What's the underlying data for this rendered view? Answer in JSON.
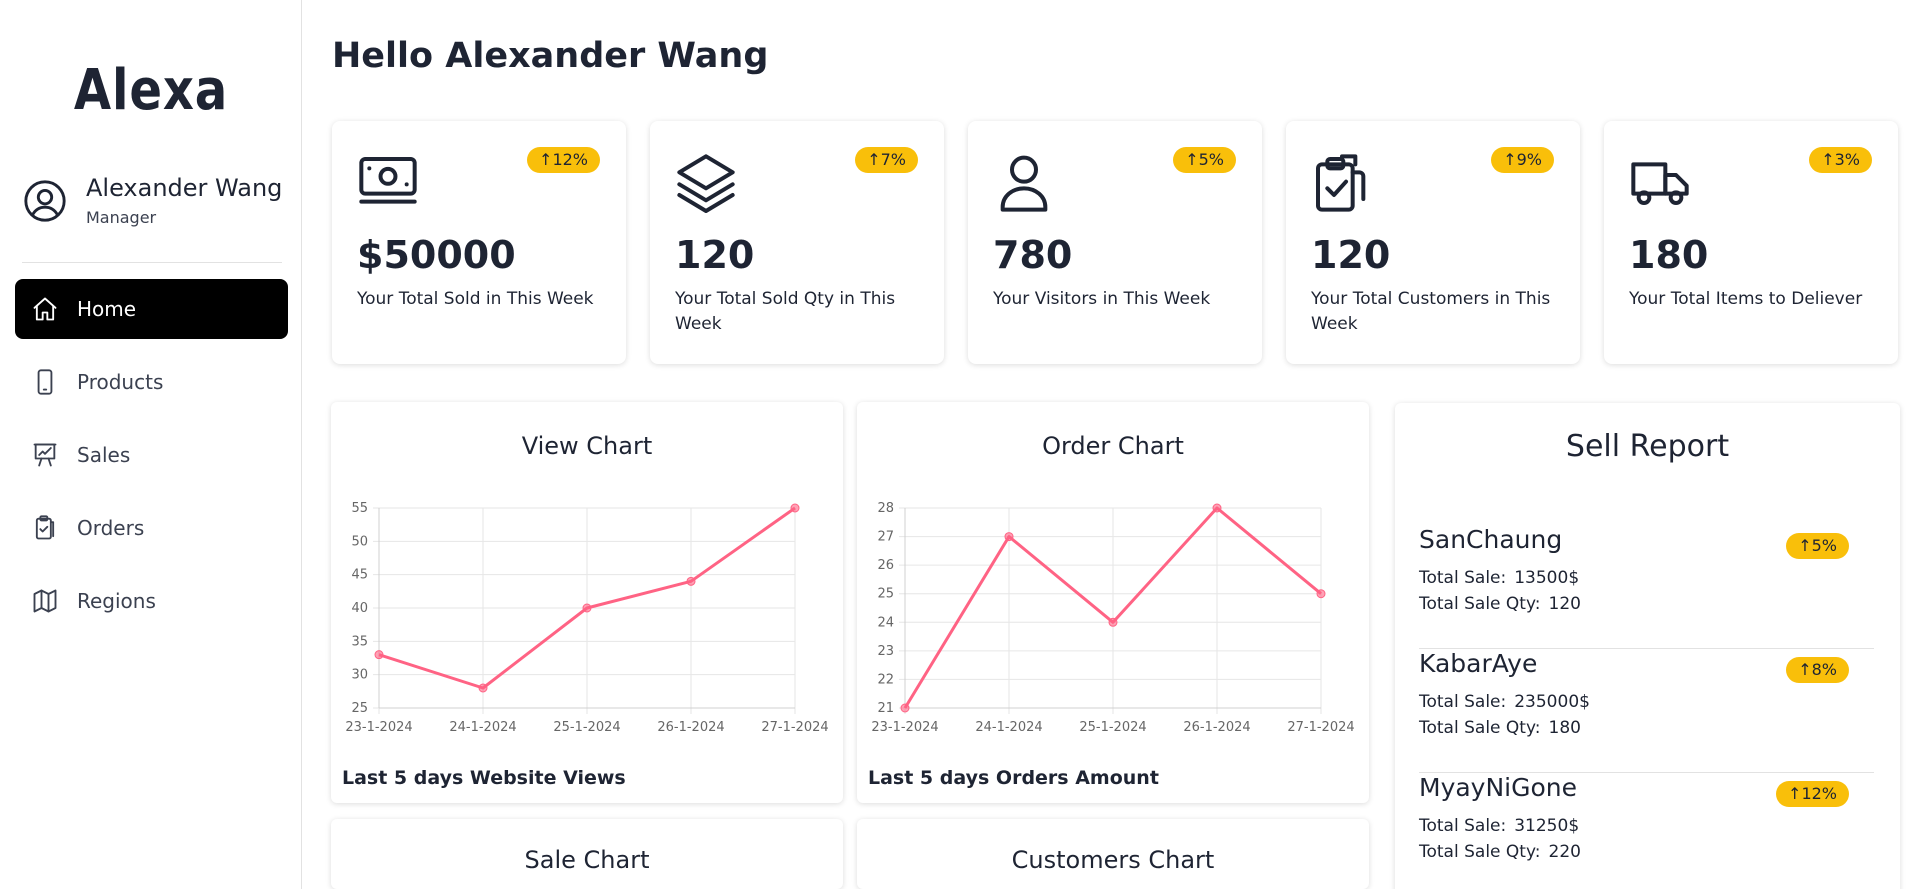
{
  "app": {
    "brand": "Alexa"
  },
  "profile": {
    "name": "Alexander Wang",
    "role": "Manager"
  },
  "nav": [
    {
      "label": "Home",
      "icon": "home-icon",
      "active": true
    },
    {
      "label": "Products",
      "icon": "smartphone-icon",
      "active": false
    },
    {
      "label": "Sales",
      "icon": "presentation-chart-icon",
      "active": false
    },
    {
      "label": "Orders",
      "icon": "clipboard-check-icon",
      "active": false
    },
    {
      "label": "Regions",
      "icon": "map-icon",
      "active": false
    }
  ],
  "greeting": "Hello Alexander Wang",
  "accent": {
    "badge": "#f9bf0a",
    "line": "#ff6384",
    "nav_active_bg": "#000000"
  },
  "stats": [
    {
      "icon": "cash-icon",
      "badge": "↑12%",
      "value": "$50000",
      "label": "Your Total Sold in This Week"
    },
    {
      "icon": "layers-icon",
      "badge": "↑7%",
      "value": "120",
      "label": "Your Total Sold Qty in This Week"
    },
    {
      "icon": "user-icon",
      "badge": "↑5%",
      "value": "780",
      "label": "Your Visitors in This Week"
    },
    {
      "icon": "clipboard-check-icon",
      "badge": "↑9%",
      "value": "120",
      "label": "Your Total Customers in This Week"
    },
    {
      "icon": "truck-icon",
      "badge": "↑3%",
      "value": "180",
      "label": "Your Total Items to Deliever"
    }
  ],
  "charts": {
    "view": {
      "title": "View Chart",
      "caption": "Last 5 days Website Views"
    },
    "order": {
      "title": "Order Chart",
      "caption": "Last 5 days Orders Amount"
    },
    "sale": {
      "title": "Sale Chart"
    },
    "customers": {
      "title": "Customers Chart"
    }
  },
  "chart_data": [
    {
      "type": "line",
      "title": "View Chart",
      "categories": [
        "23-1-2024",
        "24-1-2024",
        "25-1-2024",
        "26-1-2024",
        "27-1-2024"
      ],
      "values": [
        33,
        28,
        40,
        44,
        55
      ],
      "ylim": [
        25,
        55
      ],
      "yticks": [
        25,
        30,
        35,
        40,
        45,
        50,
        55
      ],
      "grid": true,
      "color": "#ff6384"
    },
    {
      "type": "line",
      "title": "Order Chart",
      "categories": [
        "23-1-2024",
        "24-1-2024",
        "25-1-2024",
        "26-1-2024",
        "27-1-2024"
      ],
      "values": [
        21,
        27,
        24,
        28,
        25
      ],
      "ylim": [
        21,
        28
      ],
      "yticks": [
        21,
        22,
        23,
        24,
        25,
        26,
        27,
        28
      ],
      "grid": true,
      "color": "#ff6384"
    }
  ],
  "report": {
    "title": "Sell Report",
    "sale_label": "Total Sale:",
    "qty_label": "Total Sale Qty:",
    "items": [
      {
        "name": "SanChaung",
        "badge": "↑5%",
        "sale": "13500$",
        "qty": "120"
      },
      {
        "name": "KabarAye",
        "badge": "↑8%",
        "sale": "235000$",
        "qty": "180"
      },
      {
        "name": "MyayNiGone",
        "badge": "↑12%",
        "sale": "31250$",
        "qty": "220"
      }
    ]
  }
}
